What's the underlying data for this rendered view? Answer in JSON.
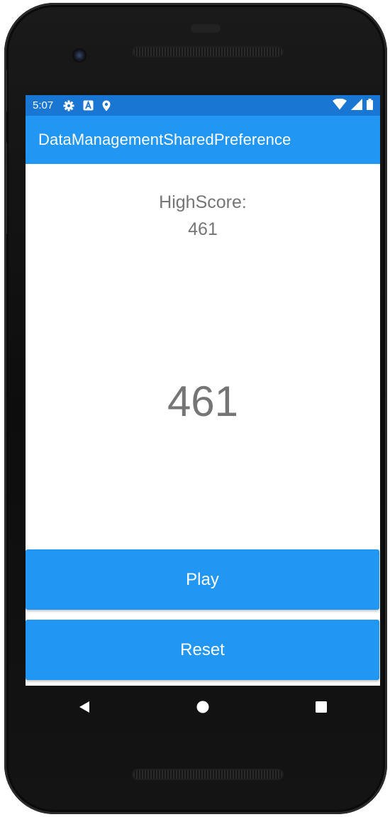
{
  "status_bar": {
    "time": "5:07",
    "icons": [
      "settings-icon",
      "a-badge-icon",
      "location-icon"
    ],
    "right_icons": [
      "wifi-icon",
      "signal-icon",
      "battery-icon"
    ]
  },
  "app_bar": {
    "title": "DataManagementSharedPreference"
  },
  "content": {
    "highscore_label": "HighScore:",
    "highscore_value": "461",
    "current_score": "461"
  },
  "buttons": {
    "play_label": "Play",
    "reset_label": "Reset"
  },
  "nav_bar": {
    "icons": [
      "back-icon",
      "home-icon",
      "recents-icon"
    ]
  },
  "colors": {
    "status_bar": "#1976d2",
    "primary": "#2196f3",
    "text_secondary": "#757575"
  }
}
